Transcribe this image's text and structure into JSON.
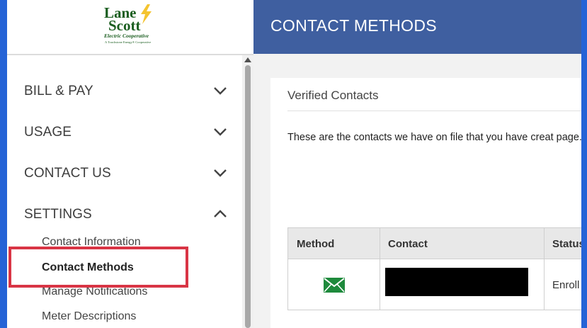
{
  "logo": {
    "line1": "Lane",
    "line2": "Scott",
    "tagline": "Electric Cooperative",
    "subtag": "A Touchstone Energy® Cooperative"
  },
  "sidebar": {
    "items": [
      {
        "label": "BILL & PAY",
        "state": "collapsed"
      },
      {
        "label": "USAGE",
        "state": "collapsed"
      },
      {
        "label": "CONTACT US",
        "state": "collapsed"
      },
      {
        "label": "SETTINGS",
        "state": "expanded"
      }
    ],
    "settings_subitems": [
      {
        "label": "Contact Information"
      },
      {
        "label": "Contact Methods",
        "active": true
      },
      {
        "label": "Manage Notifications"
      },
      {
        "label": "Meter Descriptions"
      }
    ]
  },
  "header": {
    "title": "CONTACT METHODS"
  },
  "card": {
    "title": "Verified Contacts",
    "description": "These are the contacts we have on file that you have creat page."
  },
  "table": {
    "columns": [
      "Method",
      "Contact",
      "Status"
    ],
    "rows": [
      {
        "method_icon": "envelope-icon",
        "contact": "",
        "status": "Enroll"
      }
    ]
  },
  "colors": {
    "header_bg": "#3f5fa0",
    "highlight": "#d93545",
    "border": "#2563d6",
    "logo_green": "#1b5e20",
    "envelope_green": "#1e8a3c"
  }
}
